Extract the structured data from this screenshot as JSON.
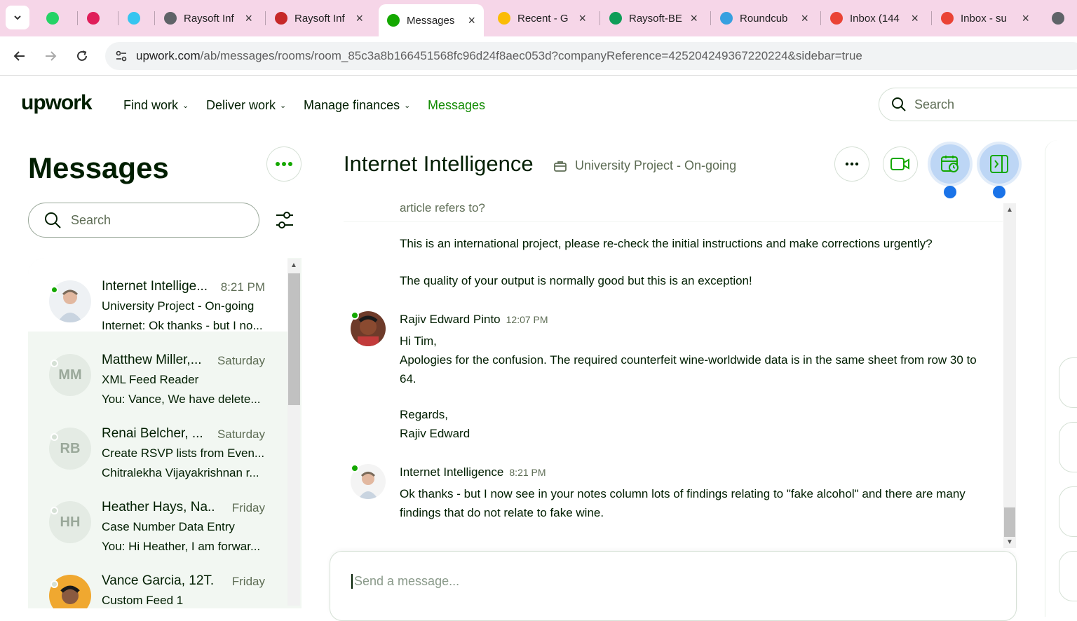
{
  "browser": {
    "tabs": [
      {
        "title": "",
        "icon": "whatsapp-icon",
        "color": "#25d366"
      },
      {
        "title": "",
        "icon": "slack-icon",
        "color": "#e01e5a"
      },
      {
        "title": "",
        "icon": "slack-icon",
        "color": "#36c5f0"
      },
      {
        "title": "Raysoft Inf",
        "icon": "globe-icon",
        "color": "#5f6368"
      },
      {
        "title": "Raysoft Inf",
        "icon": "raysoft-icon",
        "color": "#c62828"
      },
      {
        "title": "Messages",
        "icon": "upwork-icon",
        "color": "#14a800"
      },
      {
        "title": "Recent - G",
        "icon": "google-drive-icon",
        "color": "#fbbc04"
      },
      {
        "title": "Raysoft-BE",
        "icon": "google-sheets-icon",
        "color": "#0f9d58"
      },
      {
        "title": "Roundcub",
        "icon": "roundcube-icon",
        "color": "#37a0e0"
      },
      {
        "title": "Inbox (144",
        "icon": "gmail-icon",
        "color": "#ea4335"
      },
      {
        "title": "Inbox - su",
        "icon": "gmail-icon",
        "color": "#ea4335"
      },
      {
        "title": "",
        "icon": "phone-icon",
        "color": "#5f6368"
      }
    ],
    "url_host": "upwork.com",
    "url_path": "/ab/messages/rooms/room_85c3a8b166451568fc96d24f8aec053d?companyReference=425204249367220224&sidebar=true"
  },
  "header": {
    "logo": "upwork",
    "nav": [
      "Find work",
      "Deliver work",
      "Manage finances",
      "Messages"
    ],
    "search_placeholder": "Search"
  },
  "sidebar": {
    "title": "Messages",
    "search_placeholder": "Search",
    "conversations": [
      {
        "name": "Internet Intellige...",
        "time": "8:21 PM",
        "line1": "University Project - On-going",
        "line2": "Internet: Ok thanks - but I no...",
        "initials": "",
        "online": true,
        "photo": true
      },
      {
        "name": "Matthew Miller,...",
        "time": "Saturday",
        "line1": "XML Feed Reader",
        "line2": "You: Vance, We have delete...",
        "initials": "MM",
        "online": false,
        "photo": false
      },
      {
        "name": "Renai Belcher, ...",
        "time": "Saturday",
        "line1": "Create RSVP lists from Even...",
        "line2": "Chitralekha Vijayakrishnan r...",
        "initials": "RB",
        "online": false,
        "photo": false
      },
      {
        "name": "Heather Hays, Na...",
        "time": "Friday",
        "line1": "Case Number Data Entry",
        "line2": "You: Hi Heather, I am forwar...",
        "initials": "HH",
        "online": false,
        "photo": false
      },
      {
        "name": "Vance Garcia, 12T...",
        "time": "Friday",
        "line1": "Custom Feed 1",
        "line2": "",
        "initials": "",
        "online": false,
        "photo": true
      }
    ]
  },
  "room": {
    "title": "Internet Intelligence",
    "subtitle": "University Project - On-going"
  },
  "thread": {
    "partial_top": "article refers to?",
    "msg_a_1": "This is an international project, please re-check the initial instructions and make corrections urgently?",
    "msg_a_2": "The quality of your output is normally good but this is an exception!",
    "sender_b": "Rajiv Edward Pinto",
    "time_b": "12:07 PM",
    "msg_b_1": "Hi Tim,",
    "msg_b_2": "Apologies for the confusion. The required counterfeit wine-worldwide data is in the same sheet from row 30 to 64.",
    "msg_b_3": "Regards,",
    "msg_b_4": "Rajiv Edward",
    "sender_c": "Internet Intelligence",
    "time_c": "8:21 PM",
    "msg_c_1": "Ok thanks - but I now see in your notes column lots of findings relating to \"fake alcohol\" and there are many findings that do not relate to fake wine."
  },
  "compose": {
    "placeholder": "Send a message..."
  }
}
